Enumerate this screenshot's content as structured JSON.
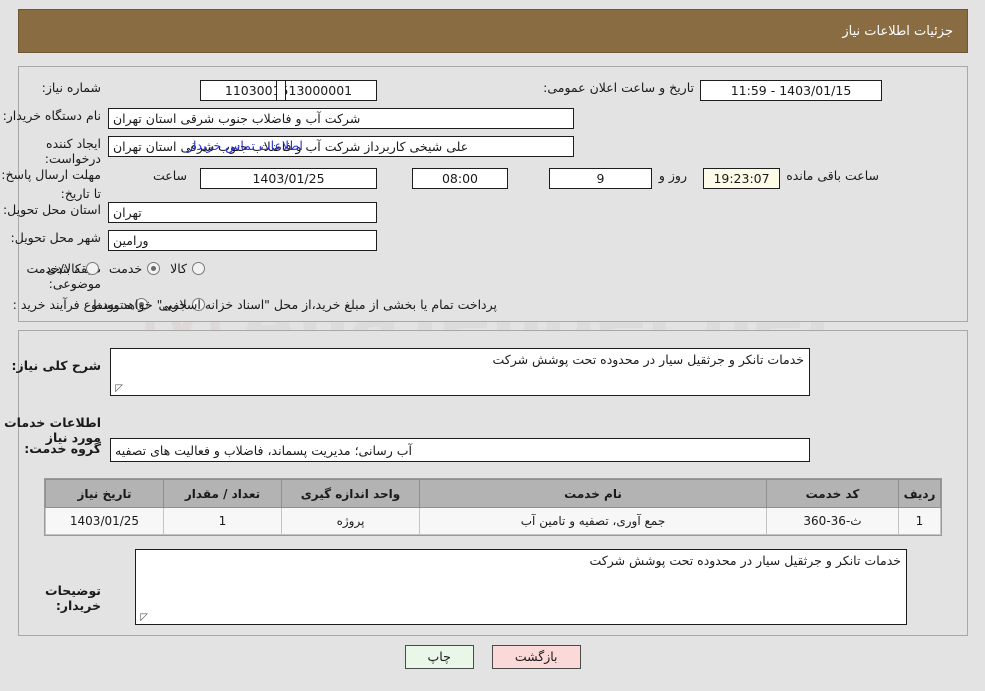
{
  "header": {
    "title": "جزئیات اطلاعات نیاز"
  },
  "fields": {
    "need_number_label": "شماره نیاز:",
    "need_number_value": "1103001513000001",
    "announce_label": "تاریخ و ساعت اعلان عمومی:",
    "announce_value": "1403/01/15 - 11:59",
    "buyer_org_label": "نام دستگاه خریدار:",
    "buyer_org_value": "شرکت آب و فاضلاب جنوب شرقی استان تهران",
    "creator_label": "ایجاد کننده درخواست:",
    "creator_value": "علی شیخی کاربرداز شرکت آب و فاضلاب جنوب شرقی استان تهران",
    "contact_link": "اطلاعات تماس خریدار",
    "deadline_label": "مهلت ارسال پاسخ: تا تاریخ:",
    "deadline_date": "1403/01/25",
    "hour_label": "ساعت",
    "deadline_time": "08:00",
    "days_value": "9",
    "days_label": "روز و",
    "countdown_value": "19:23:07",
    "remaining_label": "ساعت باقی مانده",
    "province_label": "استان محل تحویل:",
    "province_value": "تهران",
    "city_label": "شهر محل تحویل:",
    "city_value": "ورامین",
    "category_label": "طبقه بندی موضوعی:",
    "process_label": "نوع فرآیند خرید :",
    "payment_note": "پرداخت تمام یا بخشی از مبلغ خرید،از محل \"اسناد خزانه اسلامی\" خواهد بود."
  },
  "category_options": [
    {
      "label": "کالا",
      "selected": false
    },
    {
      "label": "خدمت",
      "selected": true
    },
    {
      "label": "کالا/خدمت",
      "selected": false
    }
  ],
  "process_options": [
    {
      "label": "جزیی",
      "selected": false
    },
    {
      "label": "متوسط",
      "selected": true
    }
  ],
  "description": {
    "label": "شرح کلی نیاز:",
    "value": "خدمات تانکر و جرثقیل سیار در محدوده تحت پوشش شرکت"
  },
  "services_section": {
    "heading": "اطلاعات خدمات مورد نیاز",
    "group_label": "گروه خدمت:",
    "group_value": "آب رسانی؛ مدیریت پسماند، فاضلاب و فعالیت های تصفیه"
  },
  "table": {
    "columns": [
      "ردیف",
      "کد خدمت",
      "نام خدمت",
      "واحد اندازه گیری",
      "تعداد / مقدار",
      "تاریخ نیاز"
    ],
    "rows": [
      {
        "row": "1",
        "code": "ث-36-360",
        "name": "جمع آوری، تصفیه و تامین آب",
        "unit": "پروژه",
        "qty": "1",
        "date": "1403/01/25"
      }
    ]
  },
  "buyer_notes": {
    "label": "توضیحات خریدار:",
    "value": "خدمات تانکر و جرثقیل سیار در محدوده تحت پوشش شرکت"
  },
  "buttons": {
    "print": "چاپ",
    "back": "بازگشت"
  },
  "colors": {
    "header_bg": "#8a6c43",
    "link": "#2a32d0",
    "table_header": "#b3b3b3",
    "print_btn": "#e9f7e9",
    "back_btn": "#fbd9d9"
  },
  "watermark": {
    "text": "AnaTender.net"
  }
}
